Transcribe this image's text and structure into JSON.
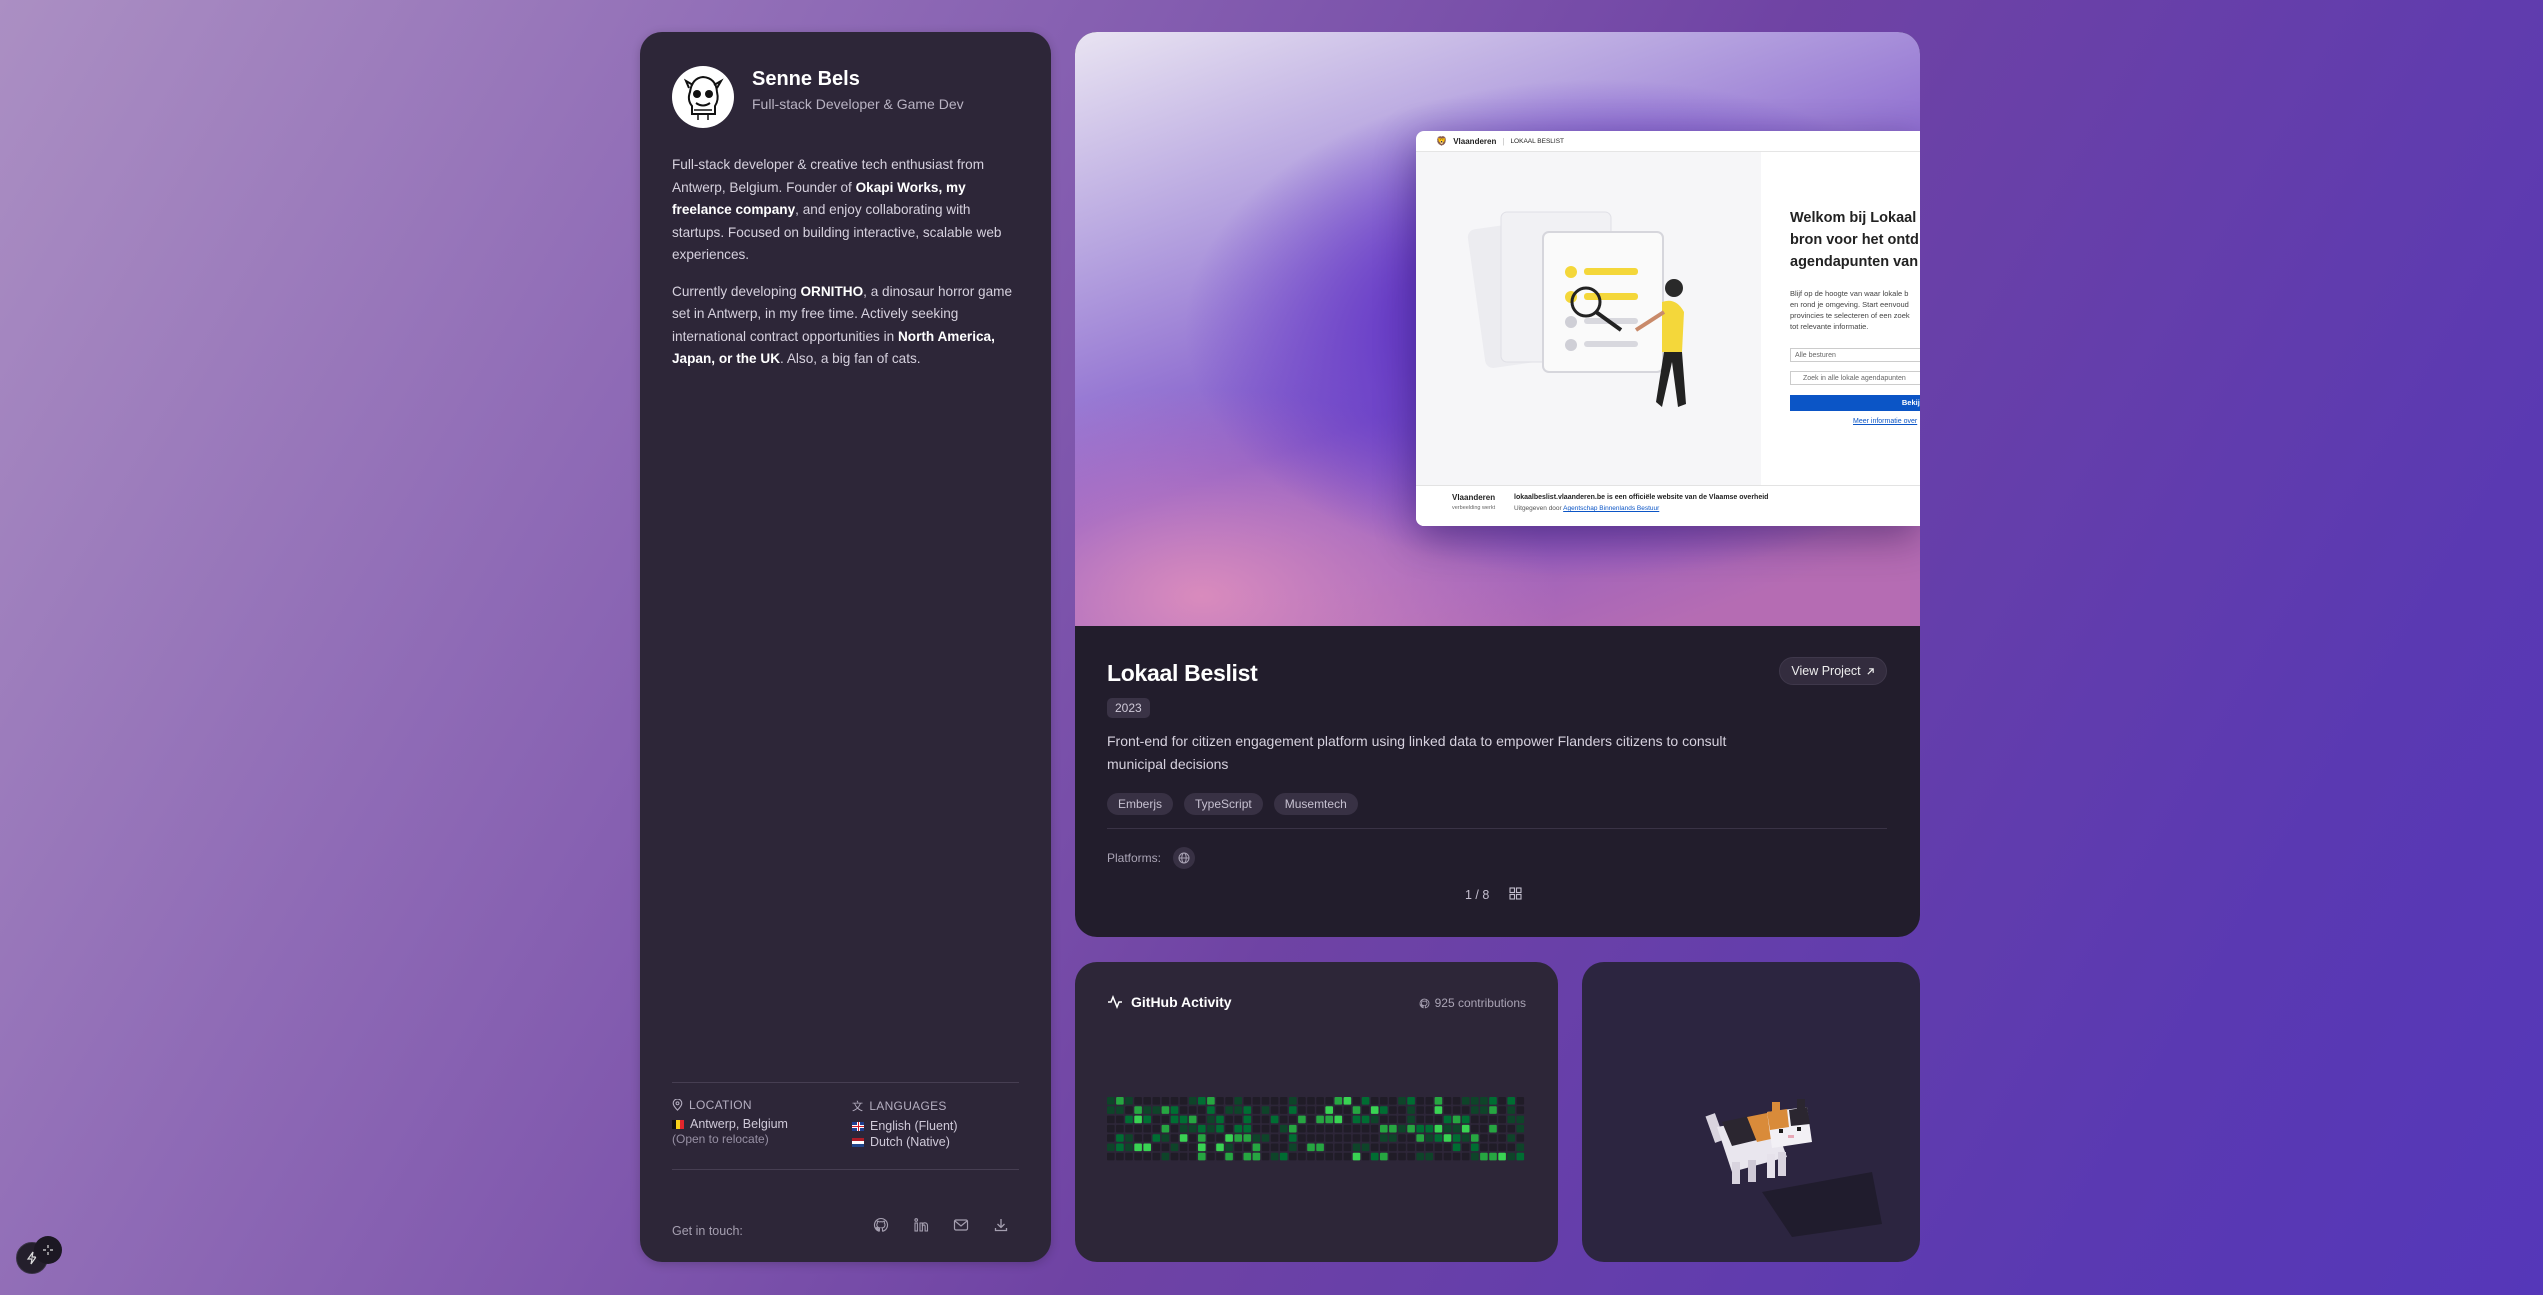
{
  "profile": {
    "name": "Senne Bels",
    "subtitle": "Full-stack Developer & Game Dev",
    "bio1": {
      "a": "Full-stack developer & creative tech enthusiast from Antwerp, Belgium. Founder of ",
      "b": "Okapi Works, my freelance company",
      "c": ", and enjoy collaborating with startups. Focused on building interactive, scalable web experiences."
    },
    "bio2": {
      "a": "Currently developing ",
      "b": "ORNITHO",
      "c": ", a dinosaur horror game set in Antwerp, in my free time. Actively seeking international contract opportunities in ",
      "d": "North America, Japan, or the UK",
      "e": ". Also, a big fan of cats."
    },
    "location": {
      "heading": "LOCATION",
      "value": "Antwerp, Belgium",
      "note": "(Open to relocate)"
    },
    "languages": {
      "heading": "LANGUAGES",
      "items": [
        "English (Fluent)",
        "Dutch (Native)"
      ]
    },
    "contact_label": "Get in touch:",
    "socials": [
      "github-icon",
      "linkedin-icon",
      "mail-icon",
      "download-icon"
    ]
  },
  "project": {
    "title": "Lokaal Beslist",
    "year": "2023",
    "view_label": "View Project",
    "description": "Front-end for citizen engagement platform using linked data to empower Flanders citizens to consult municipal decisions",
    "tags": [
      "Emberjs",
      "TypeScript",
      "Musemtech"
    ],
    "platforms_label": "Platforms:",
    "pager": "1 / 8",
    "screenshot": {
      "brand": "Vlaanderen",
      "crumb": "LOKAAL BESLIST",
      "welcome_lines": [
        "Welkom bij Lokaal B",
        "bron voor het ontd",
        "agendapunten van l"
      ],
      "text_lines": [
        "Blijf op de hoogte van waar lokale b",
        "en rond je omgeving. Start eenvoud",
        "provincies te selecteren of een zoek",
        "tot relevante informatie."
      ],
      "select_placeholder": "Alle besturen",
      "search_placeholder": "Zoek in alle lokale agendapunten",
      "button": "Bekijk",
      "link": "Meer informatie over",
      "footer_brand": "Vlaanderen",
      "footer_tag": "verbeelding werkt",
      "footer_line1": "lokaalbeslist.vlaanderen.be is een officiële website van de Vlaamse overheid",
      "footer_line2_a": "Uitgegeven door ",
      "footer_line2_b": "Agentschap Binnenlands Bestuur"
    }
  },
  "github": {
    "title": "GitHub Activity",
    "count": "925 contributions",
    "colors": [
      "#201c27",
      "#0e4429",
      "#006d32",
      "#26a641",
      "#39d353"
    ]
  },
  "colors": {
    "card": "#2d2638",
    "accent": "#39d353",
    "link": "#0b55c6"
  }
}
